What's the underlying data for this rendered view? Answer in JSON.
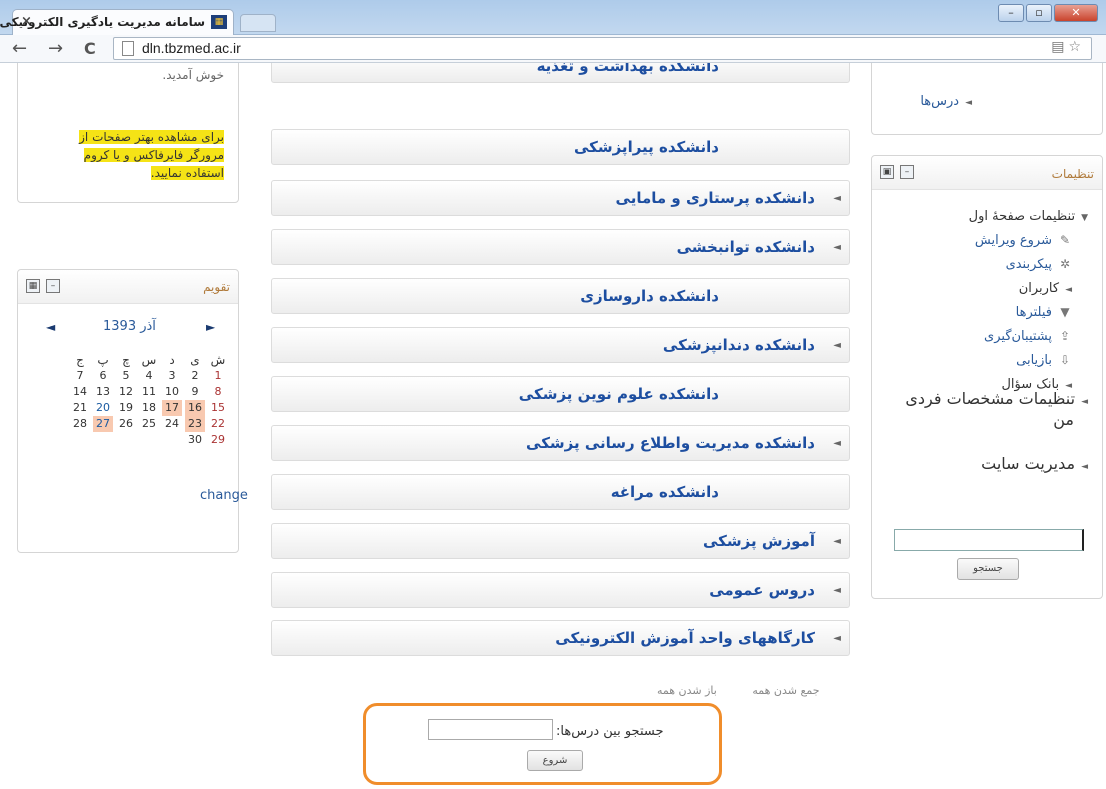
{
  "browser": {
    "tab_title": "سامانه مدیریت یادگیری الکترونیکی",
    "tab_close": "×",
    "url": "dln.tbzmed.ac.ir",
    "back": "←",
    "forward": "→",
    "reload": "C"
  },
  "welcome": {
    "text": "خوش آمدید.",
    "note": "برای مشاهده بهتر صفحات از مرورگر فایرفاکس و یا کروم استفاده نمایید."
  },
  "calendar": {
    "title": "تقویم",
    "month": "آذر 1393",
    "prev": "◄",
    "next": "►",
    "weekdays": [
      "ش",
      "ی",
      "د",
      "س",
      "چ",
      "پ",
      "ج"
    ],
    "weeks": [
      [
        "1",
        "2",
        "3",
        "4",
        "5",
        "6",
        "7"
      ],
      [
        "8",
        "9",
        "10",
        "11",
        "12",
        "13",
        "14"
      ],
      [
        "15",
        "16",
        "17",
        "18",
        "19",
        "20",
        "21"
      ],
      [
        "22",
        "23",
        "24",
        "25",
        "26",
        "27",
        "28"
      ],
      [
        "29",
        "30",
        "",
        "",
        "",
        "",
        ""
      ]
    ],
    "change": "change"
  },
  "categories": [
    {
      "label": "دانشکده بهداشت و تغذیه",
      "arrow": false
    },
    {
      "label": "دانشکده پیراپزشکی",
      "arrow": false
    },
    {
      "label": "دانشکده پرستاری و مامایی",
      "arrow": true
    },
    {
      "label": "دانشکده توانبخشی",
      "arrow": true
    },
    {
      "label": "دانشکده داروسازی",
      "arrow": false
    },
    {
      "label": "دانشکده دندانپزشکی",
      "arrow": true
    },
    {
      "label": "دانشکده علوم نوین پزشکی",
      "arrow": false
    },
    {
      "label": "دانشکده مدیریت واطلاع رسانی پزشکی",
      "arrow": true
    },
    {
      "label": "دانشکده مراغه",
      "arrow": false
    },
    {
      "label": "آموزش پزشکی",
      "arrow": true
    },
    {
      "label": "دروس عمومی",
      "arrow": true
    },
    {
      "label": "کارگاههای واحد آموزش الکترونیکی",
      "arrow": true
    }
  ],
  "collapse": {
    "collapse_all": "جمع شدن همه",
    "expand_all": "باز شدن همه"
  },
  "course_search": {
    "label": "جستجو بین درس‌ها:",
    "button": "شروع"
  },
  "navigation": {
    "courses": "درس‌ها"
  },
  "settings": {
    "title": "تنظیمات",
    "items": [
      {
        "label": "تنظیمات صفحهٔ اول",
        "type": "expanded",
        "icon": "triangle-down-icon"
      },
      {
        "label": "شروع ویرایش",
        "type": "link",
        "icon": "pencil-icon"
      },
      {
        "label": "پیکربندی",
        "type": "link",
        "icon": "gear-icon"
      },
      {
        "label": "کاربران",
        "type": "collapsed",
        "icon": "triangle-icon"
      },
      {
        "label": "فیلترها",
        "type": "link",
        "icon": "filter-icon"
      },
      {
        "label": "پشتیبان‌گیری",
        "type": "link",
        "icon": "backup-icon"
      },
      {
        "label": "بازیابی",
        "type": "link",
        "icon": "restore-icon"
      },
      {
        "label": "بانک سؤال",
        "type": "collapsed",
        "icon": "triangle-icon"
      }
    ],
    "profile_settings_1": "تنظیمات مشخصات فردی",
    "profile_settings_2": "من",
    "site_admin": "مدیریت سایت",
    "search_button": "جستجو"
  }
}
